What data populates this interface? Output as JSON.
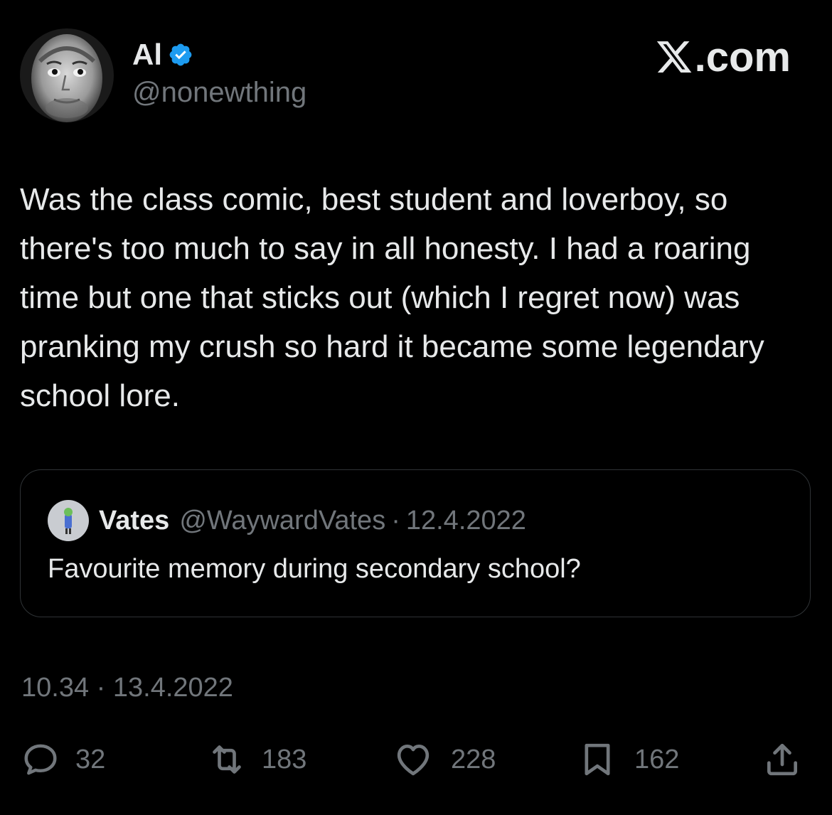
{
  "author": {
    "display_name": "Al",
    "handle": "@nonewthing",
    "verified_icon": "verified-badge-icon",
    "accent_color": "#1d9bf0"
  },
  "brand": {
    "label": ".com"
  },
  "tweet": {
    "text": "Was the class comic, best student and loverboy, so there's too much to say in all honesty. I had a roaring time but one that sticks out (which I regret now) was pranking my crush so hard it became some legendary school lore."
  },
  "quoted_tweet": {
    "display_name": "Vates",
    "handle": "@WaywardVates",
    "separator": "·",
    "date": "12.4.2022",
    "text": "Favourite memory during secondary school?"
  },
  "timestamp": "10.34 · 13.4.2022",
  "actions": {
    "replies": "32",
    "reposts": "183",
    "likes": "228",
    "bookmarks": "162"
  },
  "colors": {
    "background": "#000000",
    "primary_text": "#e7e9ea",
    "secondary_text": "#71767b",
    "border": "#2f3336"
  }
}
